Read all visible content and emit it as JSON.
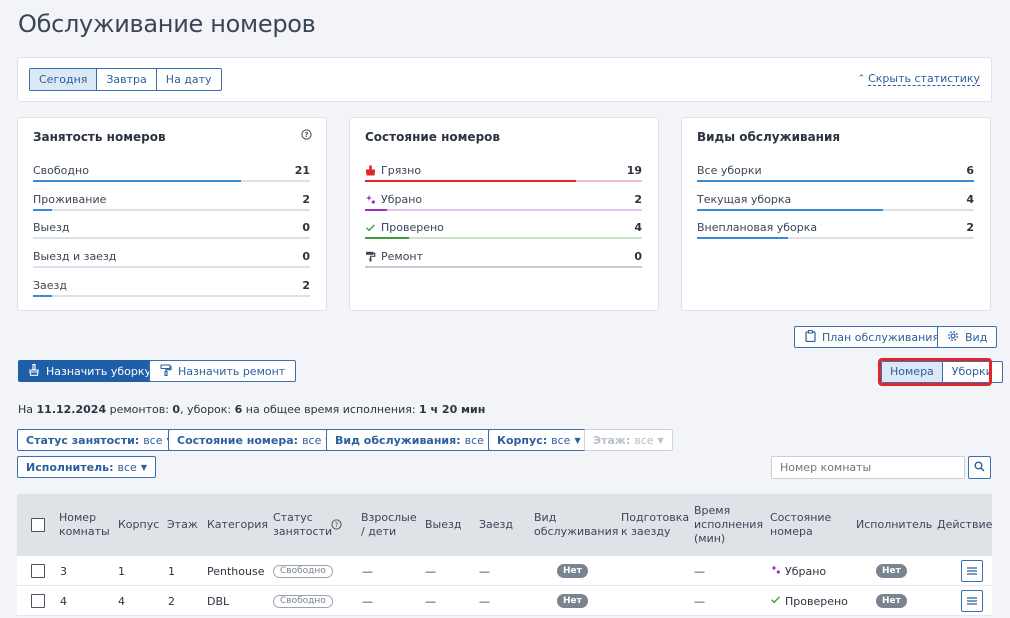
{
  "page_title": "Обслуживание номеров",
  "date_tabs": [
    "Сегодня",
    "Завтра",
    "На дату"
  ],
  "hide_stats_link": "Скрыть статистику",
  "occupancy": {
    "title": "Занятость номеров",
    "rows": [
      {
        "label": "Свободно",
        "value": "21",
        "fraction": 0.75
      },
      {
        "label": "Проживание",
        "value": "2",
        "fraction": 0.07
      },
      {
        "label": "Выезд",
        "value": "0",
        "fraction": 0
      },
      {
        "label": "Выезд и заезд",
        "value": "0",
        "fraction": 0
      },
      {
        "label": "Заезд",
        "value": "2",
        "fraction": 0.07
      }
    ]
  },
  "room_state": {
    "title": "Состояние номеров",
    "rows": [
      {
        "label": "Грязно",
        "value": "19",
        "fraction": 0.76,
        "color": "#e0262b",
        "icon": "broom-icon"
      },
      {
        "label": "Убрано",
        "value": "2",
        "fraction": 0.08,
        "color": "#9b2fbf",
        "icon": "sparkle-icon"
      },
      {
        "label": "Проверено",
        "value": "4",
        "fraction": 0.16,
        "color": "#3f9b3f",
        "icon": "check-icon"
      },
      {
        "label": "Ремонт",
        "value": "0",
        "fraction": 0,
        "color": "#3a4656",
        "icon": "paint-roller-icon"
      }
    ]
  },
  "service_types": {
    "title": "Виды обслуживания",
    "rows": [
      {
        "label": "Все уборки",
        "value": "6",
        "fraction": 1
      },
      {
        "label": "Текущая уборка",
        "value": "4",
        "fraction": 0.67
      },
      {
        "label": "Внеплановая уборка",
        "value": "2",
        "fraction": 0.33
      }
    ]
  },
  "buttons": {
    "service_plan": "План обслуживания",
    "view": "Вид",
    "assign_cleaning": "Назначить уборку",
    "assign_repair": "Назначить ремонт",
    "rooms_tab": "Номера",
    "cleanings_tab": "Уборки"
  },
  "summary": {
    "prefix": "На ",
    "date": "11.12.2024",
    "mid1": " ремонтов: ",
    "repairs": "0",
    "mid2": ", уборок: ",
    "cleanings": "6",
    "mid3": " на общее время исполнения: ",
    "total": "1 ч 20 мин"
  },
  "filters": [
    {
      "label": "Статус занятости:",
      "value": "все"
    },
    {
      "label": "Состояние номера:",
      "value": "все"
    },
    {
      "label": "Вид обслуживания:",
      "value": "все"
    },
    {
      "label": "Корпус:",
      "value": "все"
    },
    {
      "label": "Этаж:",
      "value": "все"
    },
    {
      "label": "Исполнитель:",
      "value": "все"
    }
  ],
  "search": {
    "placeholder": "Номер комнаты"
  },
  "table": {
    "headers": [
      "Номер комнаты",
      "Корпус",
      "Этаж",
      "Категория",
      "Статус занятости",
      "Взрослые / дети",
      "Выезд",
      "Заезд",
      "Вид обслуживания",
      "Подготовка к заезду",
      "Время исполнения (мин)",
      "Состояние номера",
      "Исполнитель",
      "Действие"
    ],
    "rows": [
      {
        "room": "3",
        "building": "1",
        "floor": "1",
        "category": "Penthouse",
        "status": "Свободно",
        "guests": "—",
        "checkout": "—",
        "checkin": "—",
        "service": "Нет",
        "prep": "",
        "time": "—",
        "state": "Убрано",
        "state_icon": "sparkle-icon",
        "assignee": "Нет"
      },
      {
        "room": "4",
        "building": "4",
        "floor": "2",
        "category": "DBL",
        "status": "Свободно",
        "guests": "—",
        "checkout": "—",
        "checkin": "—",
        "service": "Нет",
        "prep": "",
        "time": "—",
        "state": "Проверено",
        "state_icon": "check-icon",
        "assignee": "Нет"
      }
    ]
  }
}
